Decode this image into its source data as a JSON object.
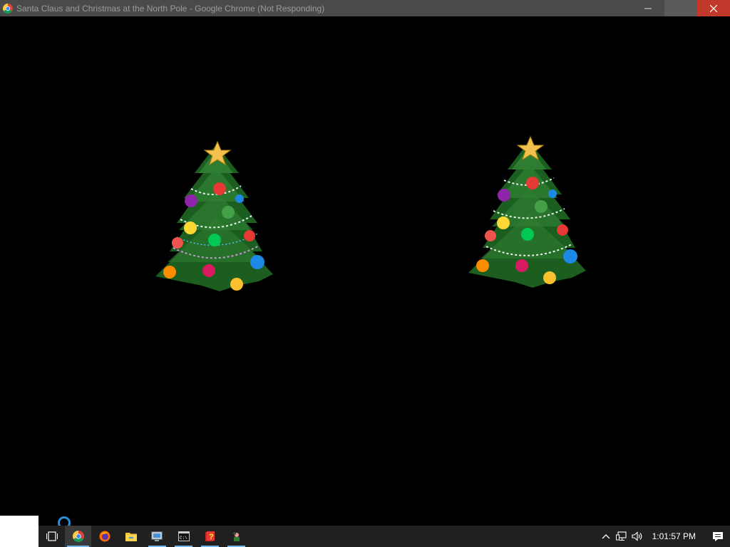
{
  "window": {
    "title": "Santa Claus and Christmas at the North Pole - Google Chrome (Not Responding)"
  },
  "content": {
    "trees": [
      {
        "name": "christmas-tree-left"
      },
      {
        "name": "christmas-tree-right"
      }
    ]
  },
  "taskbar": {
    "items": [
      {
        "name": "task-view-icon",
        "state": "normal"
      },
      {
        "name": "chrome-taskbar-icon",
        "state": "active"
      },
      {
        "name": "firefox-taskbar-icon",
        "state": "normal"
      },
      {
        "name": "file-explorer-taskbar-icon",
        "state": "normal"
      },
      {
        "name": "remote-desktop-taskbar-icon",
        "state": "running"
      },
      {
        "name": "command-prompt-taskbar-icon",
        "state": "running"
      },
      {
        "name": "help-taskbar-icon",
        "state": "running"
      },
      {
        "name": "game-taskbar-icon",
        "state": "running"
      }
    ],
    "clock": "1:01:57 PM"
  },
  "colors": {
    "titlebar": "#4a4a4a",
    "title_text": "#9b9b9b",
    "close_button": "#c0392b",
    "taskbar": "#202020",
    "accent": "#76b9ed"
  }
}
